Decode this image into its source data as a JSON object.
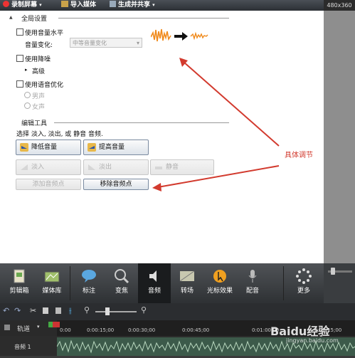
{
  "toolbar": {
    "record_screen": "录制屏幕",
    "import_media": "导入媒体",
    "produce_share": "生成并共享",
    "resolution": "480x360"
  },
  "global_settings": {
    "title": "全局设置",
    "enable_volume_leveling": "使用音量水平",
    "volume_change_label": "音量变化:",
    "volume_change_value": "中等音量变化",
    "enable_noise_removal": "使用降噪",
    "advanced": "高级",
    "enable_voice_enhancement": "使用语音优化",
    "male": "男声",
    "female": "女声"
  },
  "edit_tools": {
    "title": "编辑工具",
    "instruction": "选择 淡入, 淡出, 或 静音 音频.",
    "lower_volume": "降低音量",
    "raise_volume": "提高音量",
    "fade_in": "淡入",
    "fade_out": "淡出",
    "silence": "静音",
    "add_volume_point": "添加音频点",
    "remove_volume_point": "移除音频点"
  },
  "annotation": {
    "label": "具体调节",
    "color": "#d23a2e"
  },
  "tools": {
    "items": [
      {
        "label": "剪辑箱",
        "icon": "clip-bin-icon"
      },
      {
        "label": "媒体库",
        "icon": "library-icon"
      },
      {
        "label": "标注",
        "icon": "callout-icon"
      },
      {
        "label": "变焦",
        "icon": "zoom-icon"
      },
      {
        "label": "音频",
        "icon": "audio-icon"
      },
      {
        "label": "转场",
        "icon": "transition-icon"
      },
      {
        "label": "光标效果",
        "icon": "cursor-effects-icon"
      },
      {
        "label": "配音",
        "icon": "voice-narration-icon"
      },
      {
        "label": "更多",
        "icon": "more-icon"
      }
    ]
  },
  "timeline": {
    "tracks_label": "轨道",
    "track_name": "音频 1",
    "times": [
      "0:00",
      "0:00:15;00",
      "0:00:30;00",
      "0:00:45;00",
      "0:01:00;00",
      "0:01:15;00"
    ],
    "watermark": "Baidu经验",
    "watermark_url": "jingyan.baidu.com"
  }
}
